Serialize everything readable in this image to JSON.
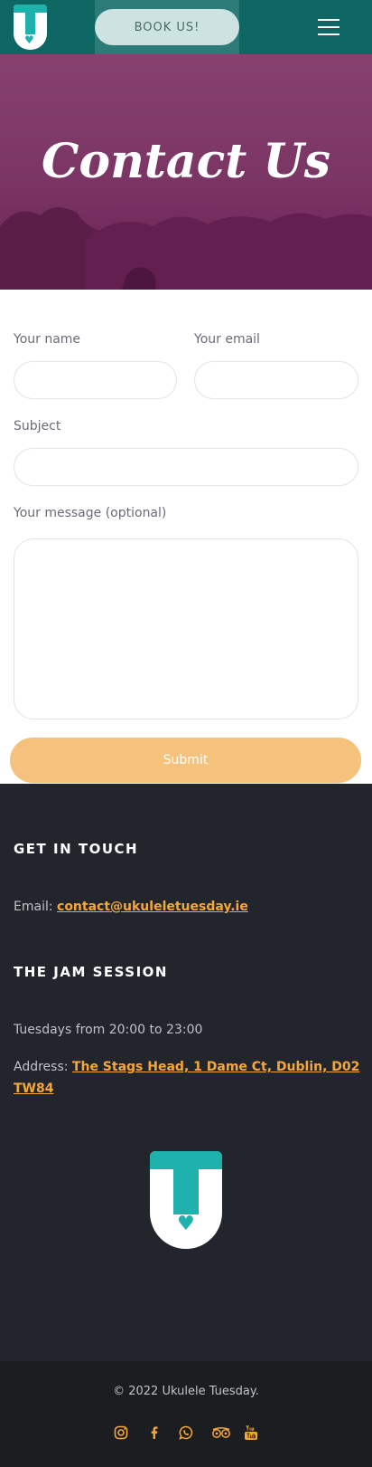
{
  "header": {
    "book_label": "BOOK US!",
    "logo_icon": "ukulele-tuesday-logo-icon",
    "menu_icon": "hamburger-menu-icon"
  },
  "hero": {
    "title": "Contact Us"
  },
  "form": {
    "name_label": "Your name",
    "email_label": "Your email",
    "subject_label": "Subject",
    "message_label": "Your message (optional)",
    "submit_label": "Submit",
    "name_value": "",
    "email_value": "",
    "subject_value": "",
    "message_value": ""
  },
  "footer": {
    "get_in_touch_heading": "GET IN TOUCH",
    "email_prefix": "Email: ",
    "email_link": "contact@ukuleletuesday.ie",
    "jam_heading": "THE JAM SESSION",
    "schedule": "Tuesdays from 20:00 to 23:00",
    "address_prefix": "Address: ",
    "address_link": "The Stags Head, 1 Dame Ct, Dublin, D02 TW84",
    "copyright": "© 2022 Ukulele Tuesday.",
    "social_icons": [
      "instagram-icon",
      "facebook-icon",
      "whatsapp-icon",
      "tripadvisor-icon",
      "youtube-icon"
    ]
  },
  "colors": {
    "header_bg": "#0e6663",
    "hero_overlay": "#7a3565",
    "submit_bg": "#f4c27d",
    "footer_bg": "#22252c",
    "link": "#f4a83a",
    "brand_teal": "#1fb2ad"
  }
}
